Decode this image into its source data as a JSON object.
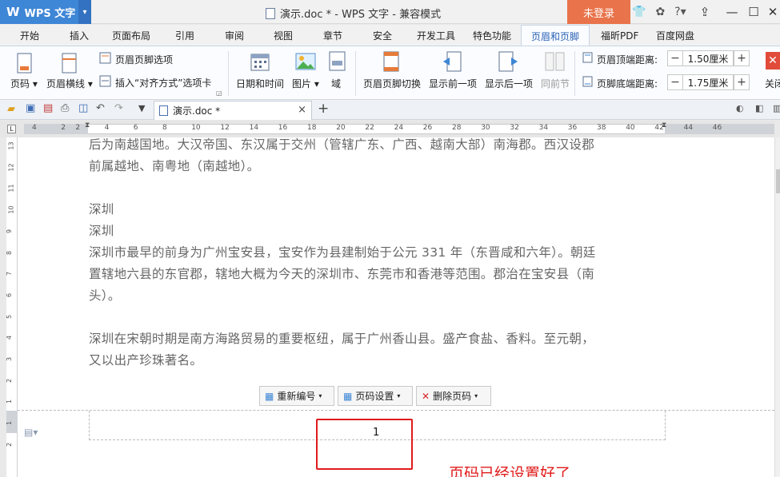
{
  "titlebar": {
    "app_name": "WPS 文字",
    "doc_title": "演示.doc * - WPS 文字 - 兼容模式",
    "login": "未登录"
  },
  "tabs": [
    "开始",
    "插入",
    "页面布局",
    "引用",
    "审阅",
    "视图",
    "章节",
    "安全",
    "开发工具",
    "特色功能",
    "页眉和页脚",
    "福昕PDF",
    "百度网盘"
  ],
  "active_tab": "页眉和页脚",
  "ribbon": {
    "page_number": "页码",
    "header_line": "页眉横线",
    "header_footer_options": "页眉页脚选项",
    "insert_align_tab": "插入“对齐方式”选项卡",
    "date_time": "日期和时间",
    "picture": "图片",
    "field": "域",
    "switch": "页眉页脚切换",
    "show_prev": "显示前一项",
    "show_next": "显示后一项",
    "same_section": "同前节",
    "header_top_label": "页眉顶端距离:",
    "header_top_value": "1.50厘米",
    "footer_bottom_label": "页脚底端距离:",
    "footer_bottom_value": "1.75厘米",
    "close": "关闭"
  },
  "doctab": {
    "name": "演示.doc *",
    "close": "×",
    "add": "+"
  },
  "ruler_h": [
    "4",
    "2",
    "2",
    "4",
    "6",
    "8",
    "10",
    "12",
    "14",
    "16",
    "18",
    "20",
    "22",
    "24",
    "26",
    "28",
    "30",
    "32",
    "34",
    "36",
    "38",
    "40",
    "42",
    "44",
    "46"
  ],
  "ruler_v": [
    "13",
    "12",
    "11",
    "10",
    "9",
    "8",
    "7",
    "6",
    "5",
    "4",
    "3",
    "2",
    "1",
    "1",
    "2"
  ],
  "document": {
    "paragraphs": [
      "后为南越国地。大汉帝国、东汉属于交州（管辖广东、广西、越南大部）南海郡。西汉设郡",
      "前属越地、南粤地（南越地）。",
      "",
      "深圳",
      "深圳",
      "深圳市最早的前身为广州宝安县，宝安作为县建制始于公元 331 年（东晋咸和六年）。朝廷",
      "置辖地六县的东官郡，辖地大概为今天的深圳市、东莞市和香港等范围。郡治在宝安县（南",
      "头）。",
      "",
      "深圳在宋朝时期是南方海路贸易的重要枢纽，属于广州香山县。盛产食盐、香料。至元朝，",
      "又以出产珍珠著名。"
    ]
  },
  "footer_toolbar": {
    "renumber": "重新编号",
    "page_setting": "页码设置",
    "delete_page": "删除页码"
  },
  "footer": {
    "page_number": "1",
    "annotation": "页码已经设置好了"
  },
  "colors": {
    "accent": "#3e86d6",
    "login": "#e9734a",
    "annotation": "#e11b1b"
  }
}
